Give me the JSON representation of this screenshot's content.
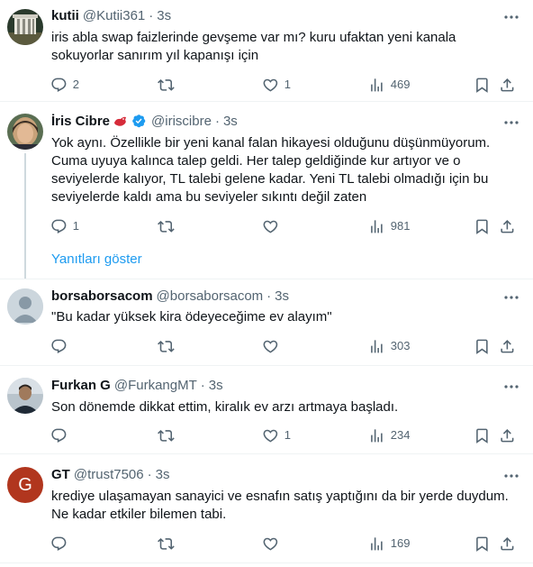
{
  "tweets": [
    {
      "name": "kutii",
      "handle": "@Kutii361",
      "time": "3s",
      "text": "iris abla swap faizlerinde gevşeme var mı? kuru ufaktan yeni kanala sokuyorlar sanırım yıl kapanışı için",
      "replies": "2",
      "retweets": "",
      "likes": "1",
      "views": "469"
    },
    {
      "name": "İris Cibre",
      "handle": "@iriscibre",
      "time": "3s",
      "text": "Yok aynı. Özellikle bir yeni kanal falan hikayesi olduğunu düşünmüyorum.\nCuma uyuya kalınca talep geldi. Her talep geldiğinde kur artıyor ve o seviyelerde kalıyor, TL talebi gelene kadar. Yeni TL talebi olmadığı için bu seviyelerde kaldı ama bu seviyeler sıkıntı değil zaten",
      "replies": "1",
      "retweets": "",
      "likes": "",
      "views": "981"
    },
    {
      "name": "borsaborsacom",
      "handle": "@borsaborsacom",
      "time": "3s",
      "text": "\"Bu kadar yüksek kira ödeyeceğime ev alayım\"",
      "replies": "",
      "retweets": "",
      "likes": "",
      "views": "303"
    },
    {
      "name": "Furkan G",
      "handle": "@FurkangMT",
      "time": "3s",
      "text": "Son dönemde dikkat ettim, kiralık ev arzı artmaya başladı.",
      "replies": "",
      "retweets": "",
      "likes": "1",
      "views": "234"
    },
    {
      "name": "GT",
      "handle": "@trust7506",
      "time": "3s",
      "text": "krediye ulaşamayan sanayici ve esnafın satış yaptığını da bir yerde duydum. Ne kadar etkiler bilemen tabi.",
      "replies": "",
      "retweets": "",
      "likes": "",
      "views": "169",
      "avatar_letter": "G"
    }
  ],
  "show_replies_label": "Yanıtları göster",
  "separator": "·",
  "colors": {
    "accent": "#1d9bf0",
    "secondary_text": "#536471",
    "verified": "#1d9bf0",
    "gt_avatar": "#b1361e"
  }
}
